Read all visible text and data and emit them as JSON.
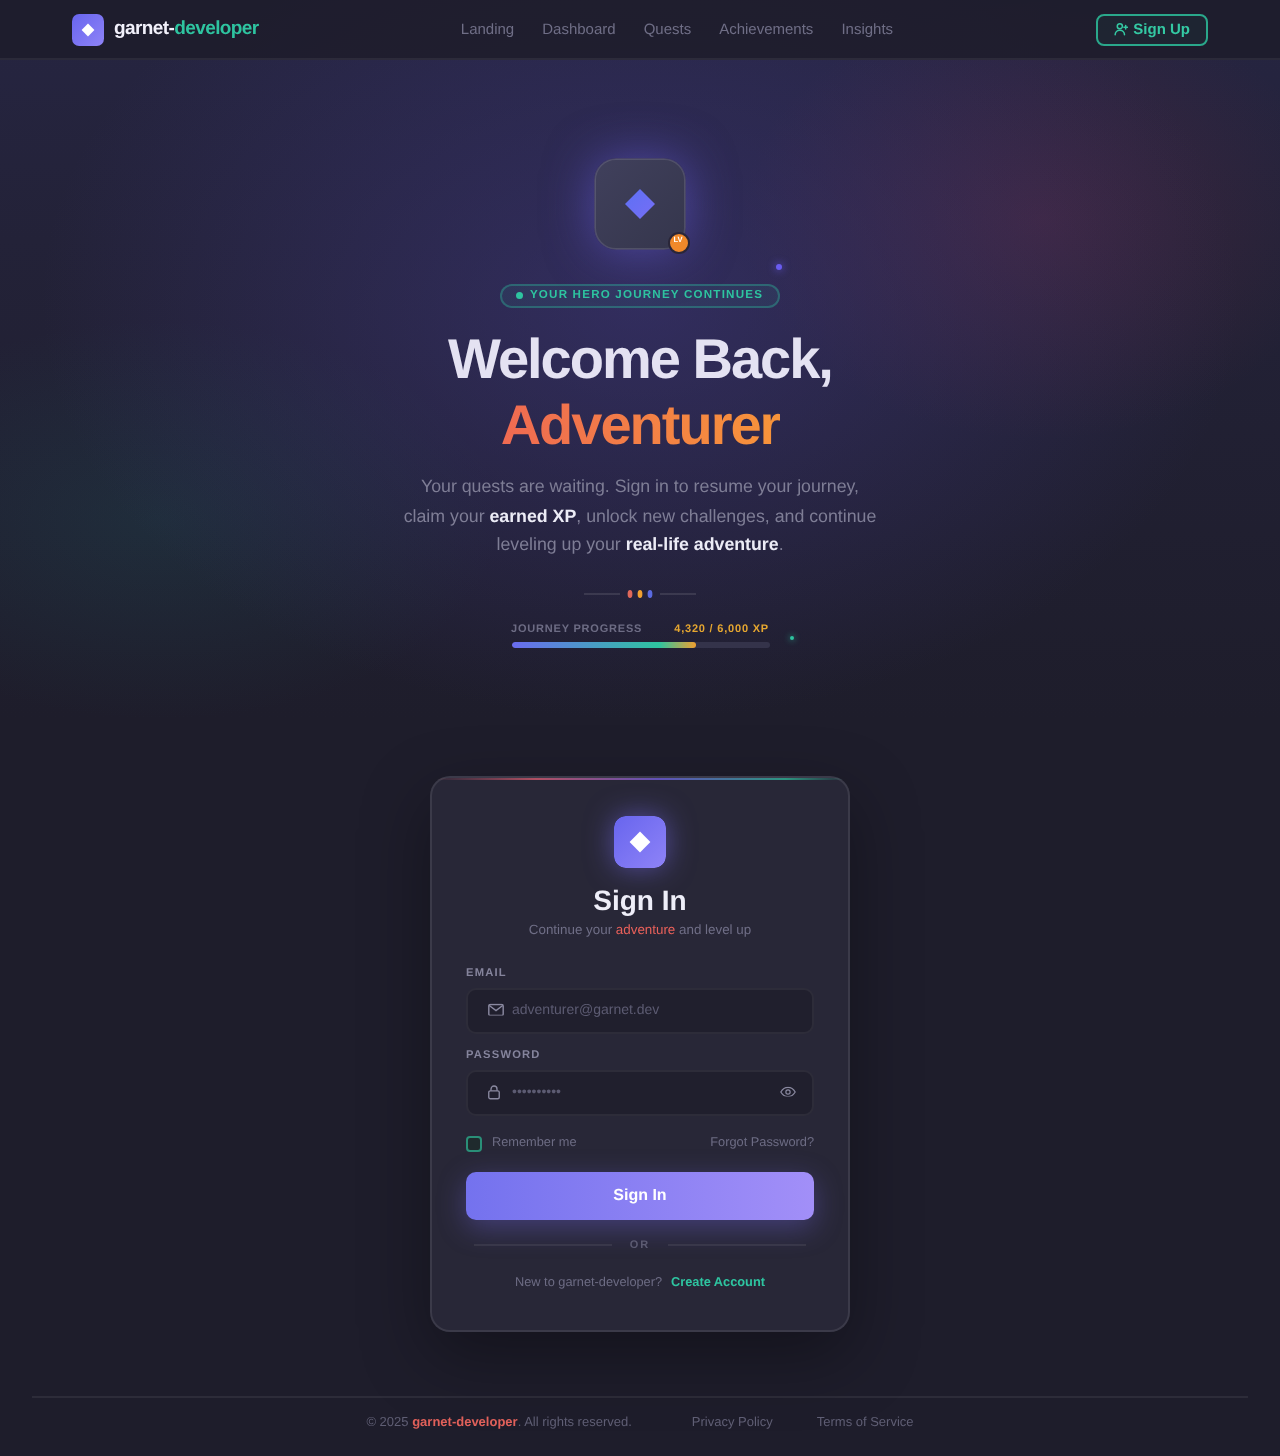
{
  "nav": {
    "brand": {
      "first": "garnet-",
      "second": "developer"
    },
    "links": [
      "Landing",
      "Dashboard",
      "Quests",
      "Achievements",
      "Insights"
    ],
    "signup_button": "Sign Up"
  },
  "hero": {
    "badge": "LV",
    "tagline": "YOUR HERO JOURNEY CONTINUES",
    "title": "Welcome Back,",
    "title_highlight": "Adventurer",
    "intro": "Your quests are waiting. Sign in to resume your journey, claim your **earned XP**, unlock new challenges, and continue leveling up your **real-life adventure**.",
    "progress": {
      "label": "JOURNEY PROGRESS",
      "reading": "4,320 / 6,000 XP",
      "level": 0.72
    }
  },
  "signin": {
    "title": "Sign In",
    "subtitle": {
      "before": "Continue your ",
      "highlight": "adventure",
      "after": " and level up"
    },
    "fields": [
      {
        "kind": "email",
        "label": "EMAIL",
        "placeholder": "adventurer@garnet.dev"
      },
      {
        "kind": "password",
        "label": "PASSWORD",
        "placeholder": "••••••••••"
      }
    ],
    "remember": {
      "label": "Remember me",
      "checked": false
    },
    "forgot_link": "Forgot Password?",
    "submit": "Sign In",
    "divider": "OR",
    "prompt": "New to garnet-developer?",
    "create_link": "Create Account"
  },
  "footer": {
    "copyright": "© 2025 **garnet-developer**. All rights reserved.",
    "links": [
      "Privacy Policy",
      "Terms of Service"
    ]
  }
}
